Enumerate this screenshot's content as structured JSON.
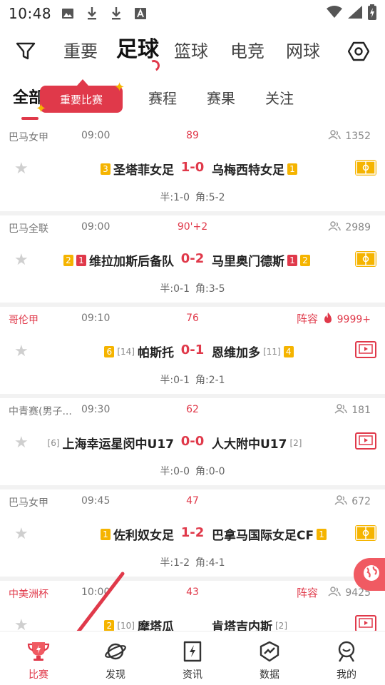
{
  "status_bar": {
    "time": "10:48"
  },
  "top_nav": {
    "sports": [
      "重要",
      "足球",
      "篮球",
      "电竞",
      "网球"
    ],
    "active_sport": "足球"
  },
  "sub_tabs": [
    "全部",
    "赛程",
    "赛果",
    "关注"
  ],
  "tooltip": "重要比赛",
  "matches": [
    {
      "league": "巴马女甲",
      "time": "09:00",
      "minute": "89",
      "fans": "1352",
      "home_badges": [
        "3"
      ],
      "home": "圣塔菲女足",
      "score": "1-0",
      "away": "乌梅西特女足",
      "away_badges": [
        "1"
      ],
      "half": "半:1-0",
      "corner": "角:5-2",
      "media": "field-icon"
    },
    {
      "league": "巴马全联",
      "time": "09:00",
      "minute": "90'+2",
      "fans": "2989",
      "home_badges": [
        "2",
        "1"
      ],
      "home": "维拉加斯后备队",
      "score": "0-2",
      "away": "马里奥门德斯",
      "away_badges": [
        "1",
        "2"
      ],
      "half": "半:0-1",
      "corner": "角:3-5",
      "media": "field-icon"
    },
    {
      "league": "哥伦甲",
      "time": "09:10",
      "minute": "76",
      "lineup": "阵容",
      "fans": "9999+",
      "home_badges": [
        "6"
      ],
      "home_rank": "[14]",
      "home": "帕斯托",
      "score": "0-1",
      "away": "恩维加多",
      "away_rank": "[11]",
      "away_badges": [
        "4"
      ],
      "half": "半:0-1",
      "corner": "角:2-1",
      "media": "tv-icon"
    },
    {
      "league": "中青赛(男子...",
      "time": "09:30",
      "minute": "62",
      "fans": "181",
      "home_rank": "[6]",
      "home": "上海幸运星闵中U17",
      "score": "0-0",
      "away": "人大附中U17",
      "away_rank": "[2]",
      "half": "半:0-0",
      "corner": "角:0-0",
      "media": "tv-icon"
    },
    {
      "league": "巴马女甲",
      "time": "09:45",
      "minute": "47",
      "fans": "672",
      "home_badges": [
        "1"
      ],
      "home": "佐利奴女足",
      "score": "1-2",
      "away": "巴拿马国际女足CF",
      "away_badges": [
        "1"
      ],
      "half": "半:1-2",
      "corner": "角:4-1",
      "media": "field-icon"
    },
    {
      "league": "中美洲杯",
      "time": "10:00",
      "minute": "43",
      "lineup": "阵容",
      "fans": "9425",
      "home_badges": [
        "2"
      ],
      "home_rank": "[10]",
      "home": "摩塔瓜",
      "score": "",
      "away": "肯塔吉内斯",
      "away_rank": "[2]",
      "media": "tv-icon"
    }
  ],
  "bottom_nav": [
    {
      "label": "比赛",
      "icon": "trophy-icon"
    },
    {
      "label": "发现",
      "icon": "planet-icon"
    },
    {
      "label": "资讯",
      "icon": "news-icon"
    },
    {
      "label": "数据",
      "icon": "data-icon"
    },
    {
      "label": "我的",
      "icon": "profile-icon"
    }
  ],
  "colors": {
    "accent": "#e0394a",
    "badge_yellow": "#f5b400"
  }
}
